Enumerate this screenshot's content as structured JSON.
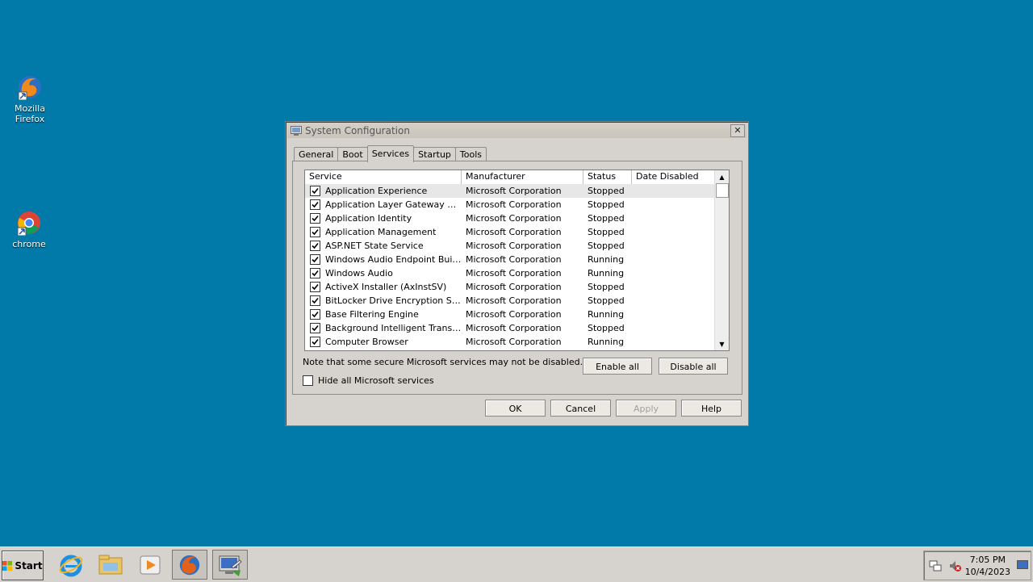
{
  "desktop": {
    "icons": [
      {
        "label": "Mozilla Firefox",
        "icon": "firefox-icon"
      },
      {
        "label": "chrome",
        "icon": "chrome-icon"
      }
    ]
  },
  "dialog": {
    "title": "System Configuration",
    "close_label": "✕",
    "tabs": [
      {
        "label": "General",
        "active": false
      },
      {
        "label": "Boot",
        "active": false
      },
      {
        "label": "Services",
        "active": true
      },
      {
        "label": "Startup",
        "active": false
      },
      {
        "label": "Tools",
        "active": false
      }
    ],
    "columns": [
      "Service",
      "Manufacturer",
      "Status",
      "Date Disabled"
    ],
    "services": [
      {
        "name": "Application Experience",
        "manufacturer": "Microsoft Corporation",
        "status": "Stopped",
        "date_disabled": "",
        "checked": true,
        "selected": true
      },
      {
        "name": "Application Layer Gateway Service",
        "manufacturer": "Microsoft Corporation",
        "status": "Stopped",
        "date_disabled": "",
        "checked": true
      },
      {
        "name": "Application Identity",
        "manufacturer": "Microsoft Corporation",
        "status": "Stopped",
        "date_disabled": "",
        "checked": true
      },
      {
        "name": "Application Management",
        "manufacturer": "Microsoft Corporation",
        "status": "Stopped",
        "date_disabled": "",
        "checked": true
      },
      {
        "name": "ASP.NET State Service",
        "manufacturer": "Microsoft Corporation",
        "status": "Stopped",
        "date_disabled": "",
        "checked": true
      },
      {
        "name": "Windows Audio Endpoint Builder",
        "manufacturer": "Microsoft Corporation",
        "status": "Running",
        "date_disabled": "",
        "checked": true
      },
      {
        "name": "Windows Audio",
        "manufacturer": "Microsoft Corporation",
        "status": "Running",
        "date_disabled": "",
        "checked": true
      },
      {
        "name": "ActiveX Installer (AxInstSV)",
        "manufacturer": "Microsoft Corporation",
        "status": "Stopped",
        "date_disabled": "",
        "checked": true
      },
      {
        "name": "BitLocker Drive Encryption Service",
        "manufacturer": "Microsoft Corporation",
        "status": "Stopped",
        "date_disabled": "",
        "checked": true
      },
      {
        "name": "Base Filtering Engine",
        "manufacturer": "Microsoft Corporation",
        "status": "Running",
        "date_disabled": "",
        "checked": true
      },
      {
        "name": "Background Intelligent Transfer ...",
        "manufacturer": "Microsoft Corporation",
        "status": "Stopped",
        "date_disabled": "",
        "checked": true
      },
      {
        "name": "Computer Browser",
        "manufacturer": "Microsoft Corporation",
        "status": "Running",
        "date_disabled": "",
        "checked": true
      }
    ],
    "note": "Note that some secure Microsoft services may not be disabled.",
    "enable_all": "Enable all",
    "disable_all": "Disable all",
    "hide_ms_label": "Hide all Microsoft services",
    "hide_ms_checked": false,
    "ok": "OK",
    "cancel": "Cancel",
    "apply": "Apply",
    "help": "Help"
  },
  "taskbar": {
    "start_label": "Start",
    "items": [
      "internet-explorer-icon",
      "file-explorer-icon",
      "media-player-icon",
      "firefox-icon",
      "system-configuration-icon"
    ],
    "clock_time": "7:05 PM",
    "clock_date": "10/4/2023"
  }
}
